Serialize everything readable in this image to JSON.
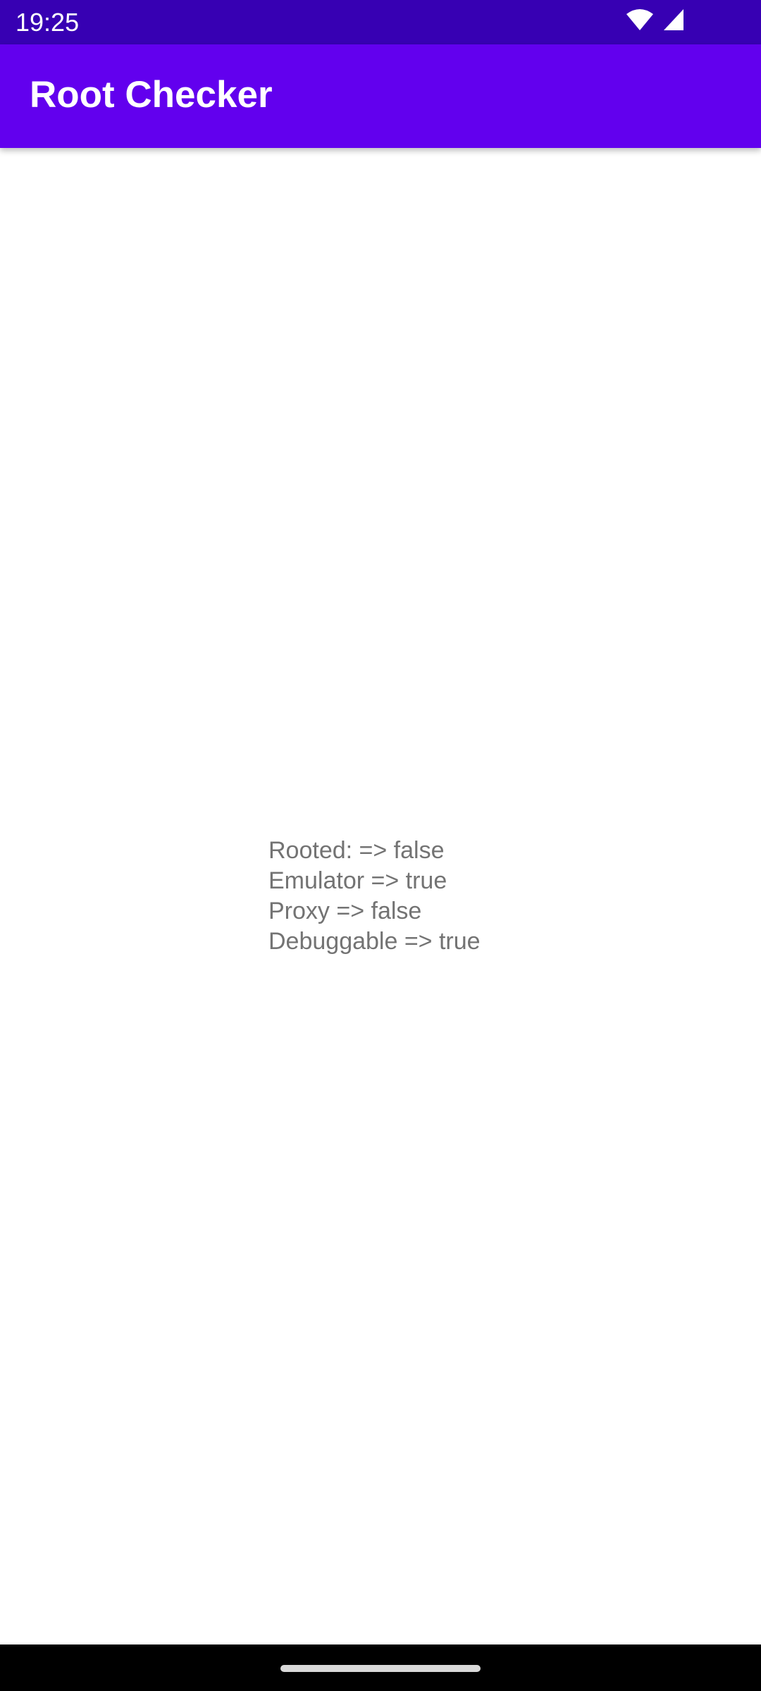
{
  "status_bar": {
    "time": "19:25",
    "icons": [
      "wifi-icon",
      "cell-signal-icon"
    ],
    "background": "#3700b3"
  },
  "app_bar": {
    "title": "Root Checker",
    "background": "#6200ee"
  },
  "results": {
    "lines": [
      "Rooted: => false",
      "Emulator => true",
      "Proxy => false",
      "Debuggable => true"
    ],
    "text_color": "#737373"
  },
  "nav_bar": {
    "background": "#000000",
    "icons": [
      "home-gesture-pill"
    ]
  }
}
